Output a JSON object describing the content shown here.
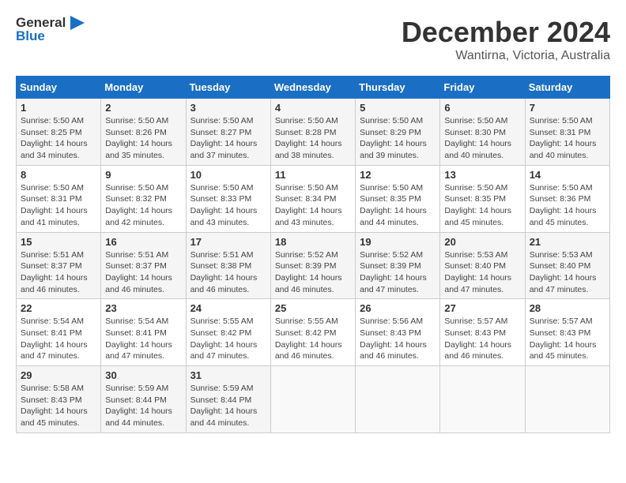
{
  "header": {
    "logo_general": "General",
    "logo_blue": "Blue",
    "month_title": "December 2024",
    "location": "Wantirna, Victoria, Australia"
  },
  "calendar": {
    "days_of_week": [
      "Sunday",
      "Monday",
      "Tuesday",
      "Wednesday",
      "Thursday",
      "Friday",
      "Saturday"
    ],
    "weeks": [
      [
        null,
        null,
        {
          "day": 3,
          "sunrise": "5:50 AM",
          "sunset": "8:27 PM",
          "daylight": "14 hours and 37 minutes."
        },
        {
          "day": 4,
          "sunrise": "5:50 AM",
          "sunset": "8:28 PM",
          "daylight": "14 hours and 38 minutes."
        },
        {
          "day": 5,
          "sunrise": "5:50 AM",
          "sunset": "8:29 PM",
          "daylight": "14 hours and 39 minutes."
        },
        {
          "day": 6,
          "sunrise": "5:50 AM",
          "sunset": "8:30 PM",
          "daylight": "14 hours and 40 minutes."
        },
        {
          "day": 7,
          "sunrise": "5:50 AM",
          "sunset": "8:31 PM",
          "daylight": "14 hours and 40 minutes."
        }
      ],
      [
        {
          "day": 1,
          "sunrise": "5:50 AM",
          "sunset": "8:25 PM",
          "daylight": "14 hours and 34 minutes."
        },
        {
          "day": 2,
          "sunrise": "5:50 AM",
          "sunset": "8:26 PM",
          "daylight": "14 hours and 35 minutes."
        },
        null,
        null,
        null,
        null,
        null
      ],
      [
        {
          "day": 8,
          "sunrise": "5:50 AM",
          "sunset": "8:31 PM",
          "daylight": "14 hours and 41 minutes."
        },
        {
          "day": 9,
          "sunrise": "5:50 AM",
          "sunset": "8:32 PM",
          "daylight": "14 hours and 42 minutes."
        },
        {
          "day": 10,
          "sunrise": "5:50 AM",
          "sunset": "8:33 PM",
          "daylight": "14 hours and 43 minutes."
        },
        {
          "day": 11,
          "sunrise": "5:50 AM",
          "sunset": "8:34 PM",
          "daylight": "14 hours and 43 minutes."
        },
        {
          "day": 12,
          "sunrise": "5:50 AM",
          "sunset": "8:35 PM",
          "daylight": "14 hours and 44 minutes."
        },
        {
          "day": 13,
          "sunrise": "5:50 AM",
          "sunset": "8:35 PM",
          "daylight": "14 hours and 45 minutes."
        },
        {
          "day": 14,
          "sunrise": "5:50 AM",
          "sunset": "8:36 PM",
          "daylight": "14 hours and 45 minutes."
        }
      ],
      [
        {
          "day": 15,
          "sunrise": "5:51 AM",
          "sunset": "8:37 PM",
          "daylight": "14 hours and 46 minutes."
        },
        {
          "day": 16,
          "sunrise": "5:51 AM",
          "sunset": "8:37 PM",
          "daylight": "14 hours and 46 minutes."
        },
        {
          "day": 17,
          "sunrise": "5:51 AM",
          "sunset": "8:38 PM",
          "daylight": "14 hours and 46 minutes."
        },
        {
          "day": 18,
          "sunrise": "5:52 AM",
          "sunset": "8:39 PM",
          "daylight": "14 hours and 46 minutes."
        },
        {
          "day": 19,
          "sunrise": "5:52 AM",
          "sunset": "8:39 PM",
          "daylight": "14 hours and 47 minutes."
        },
        {
          "day": 20,
          "sunrise": "5:53 AM",
          "sunset": "8:40 PM",
          "daylight": "14 hours and 47 minutes."
        },
        {
          "day": 21,
          "sunrise": "5:53 AM",
          "sunset": "8:40 PM",
          "daylight": "14 hours and 47 minutes."
        }
      ],
      [
        {
          "day": 22,
          "sunrise": "5:54 AM",
          "sunset": "8:41 PM",
          "daylight": "14 hours and 47 minutes."
        },
        {
          "day": 23,
          "sunrise": "5:54 AM",
          "sunset": "8:41 PM",
          "daylight": "14 hours and 47 minutes."
        },
        {
          "day": 24,
          "sunrise": "5:55 AM",
          "sunset": "8:42 PM",
          "daylight": "14 hours and 47 minutes."
        },
        {
          "day": 25,
          "sunrise": "5:55 AM",
          "sunset": "8:42 PM",
          "daylight": "14 hours and 46 minutes."
        },
        {
          "day": 26,
          "sunrise": "5:56 AM",
          "sunset": "8:43 PM",
          "daylight": "14 hours and 46 minutes."
        },
        {
          "day": 27,
          "sunrise": "5:57 AM",
          "sunset": "8:43 PM",
          "daylight": "14 hours and 46 minutes."
        },
        {
          "day": 28,
          "sunrise": "5:57 AM",
          "sunset": "8:43 PM",
          "daylight": "14 hours and 45 minutes."
        }
      ],
      [
        {
          "day": 29,
          "sunrise": "5:58 AM",
          "sunset": "8:43 PM",
          "daylight": "14 hours and 45 minutes."
        },
        {
          "day": 30,
          "sunrise": "5:59 AM",
          "sunset": "8:44 PM",
          "daylight": "14 hours and 44 minutes."
        },
        {
          "day": 31,
          "sunrise": "5:59 AM",
          "sunset": "8:44 PM",
          "daylight": "14 hours and 44 minutes."
        },
        null,
        null,
        null,
        null
      ]
    ]
  }
}
